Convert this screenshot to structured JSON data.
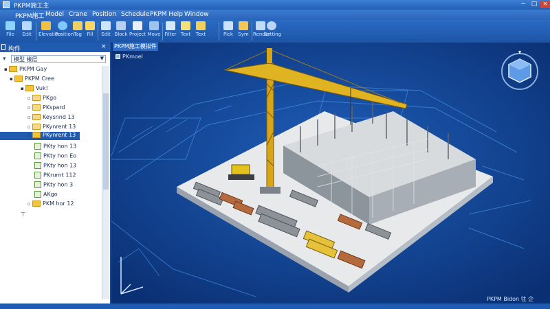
{
  "window": {
    "title": "PKPM施工主",
    "minimize": "−",
    "maximize": "□",
    "close": "×"
  },
  "menu": [
    "PKPM施工",
    "Model",
    "Crane",
    "Position",
    "Schedule",
    "PKPM Help",
    "Window"
  ],
  "toolbar": [
    {
      "label": "File",
      "icon": "file-icon",
      "color": "#8fd3ff"
    },
    {
      "label": "Edit",
      "icon": "edit-icon",
      "color": "#b7d9ff"
    },
    {
      "label": "Elevation",
      "icon": "elevation-icon",
      "color": "#f0c040"
    },
    {
      "label": "Position",
      "icon": "globe-icon",
      "color": "#7ec7ff"
    },
    {
      "label": "Tag",
      "icon": "tag-icon",
      "color": "#f0d060"
    },
    {
      "label": "Fill",
      "icon": "pencil-icon",
      "color": "#ffd760"
    },
    {
      "label": "Edit",
      "icon": "undo-icon",
      "color": "#cfe4ff"
    },
    {
      "label": "Block",
      "icon": "block-icon",
      "color": "#b5d0f0"
    },
    {
      "label": "Project",
      "icon": "arrow-right-icon",
      "color": "#e8f0ff"
    },
    {
      "label": "Move",
      "icon": "grid-icon",
      "color": "#9ec4ee"
    },
    {
      "label": "Filter",
      "icon": "filter-icon",
      "color": "#d5e6ff"
    },
    {
      "label": "Text",
      "icon": "text-icon",
      "color": "#f3e27a"
    },
    {
      "label": "Text",
      "icon": "measure-icon",
      "color": "#f0d25a"
    },
    {
      "label": "Pick",
      "icon": "pick-icon",
      "color": "#cbe1ff"
    },
    {
      "label": "Sym",
      "icon": "symbol-icon",
      "color": "#f3c85b"
    },
    {
      "label": "Render",
      "icon": "render-icon",
      "color": "#c3daf8"
    },
    {
      "label": "Setting",
      "icon": "settings-icon",
      "color": "#bcd5f5"
    },
    {
      "label": "Help",
      "icon": "help-icon",
      "color": "#f0c040"
    }
  ],
  "panel": {
    "title": "构件",
    "close": "×",
    "filter_text": "模型 楼层",
    "tree": [
      {
        "label": "PKPM Gay",
        "level": 0,
        "icon": "folder",
        "exp": "▸"
      },
      {
        "label": "PKPM Cree",
        "level": 1,
        "icon": "folder",
        "exp": "▸"
      },
      {
        "label": "Vuk!",
        "level": 2,
        "icon": "folder",
        "exp": "▸"
      },
      {
        "label": "PKgo",
        "level": 3,
        "icon": "folder",
        "exp": "▫"
      },
      {
        "label": "PKspard",
        "level": 3,
        "icon": "folder",
        "exp": "▫"
      },
      {
        "label": "Keysnnd 13",
        "level": 3,
        "icon": "folder",
        "exp": "▫"
      },
      {
        "label": "PKynrent 13",
        "level": 3,
        "icon": "folder",
        "exp": "▫"
      },
      {
        "label": "PKynrent 13",
        "level": 3,
        "icon": "folder",
        "exp": "▫",
        "selected": true
      },
      {
        "label": "PKty hon 13",
        "level": 3,
        "icon": "doc",
        "exp": ""
      },
      {
        "label": "PKty hon Eo",
        "level": 3,
        "icon": "doc",
        "exp": ""
      },
      {
        "label": "PKty hon 13",
        "level": 3,
        "icon": "doc",
        "exp": ""
      },
      {
        "label": "PKrurnt 112",
        "level": 3,
        "icon": "doc",
        "exp": ""
      },
      {
        "label": "PKty hon 3",
        "level": 3,
        "icon": "doc",
        "exp": ""
      },
      {
        "label": "AKgo",
        "level": 3,
        "icon": "doc",
        "exp": ""
      },
      {
        "label": "PKM hor 12",
        "level": 2,
        "icon": "folder",
        "exp": "▫"
      }
    ]
  },
  "viewport": {
    "tab": "PKPM施工模拟件",
    "label": "PKmoel"
  },
  "status": {
    "text": "PKPM Bidon 往 企"
  }
}
